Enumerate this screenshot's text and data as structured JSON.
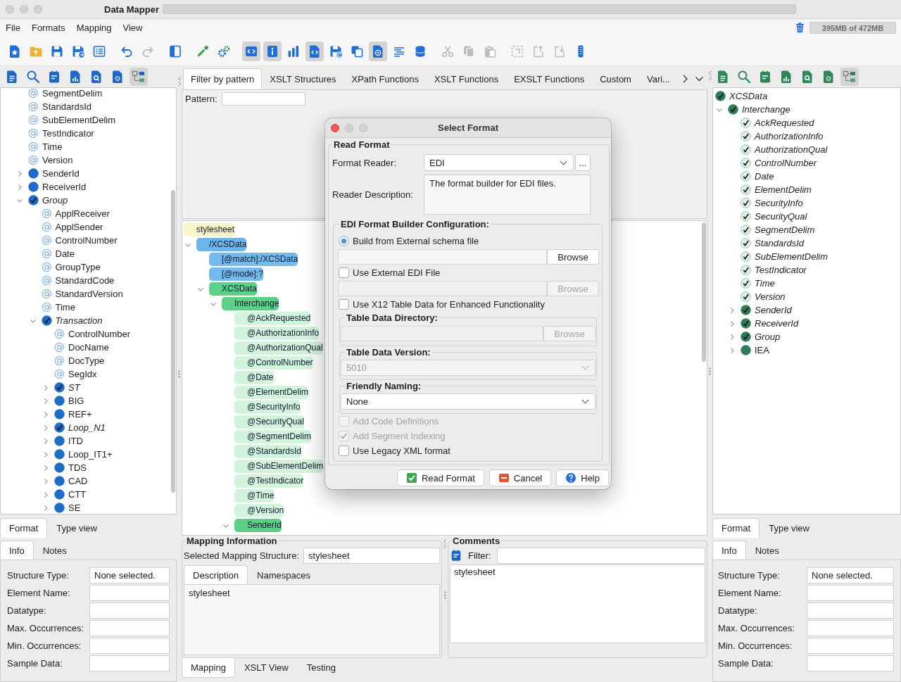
{
  "window": {
    "title": "Data Mapper"
  },
  "menu": [
    {
      "label": "File"
    },
    {
      "label": "Formats"
    },
    {
      "label": "Mapping"
    },
    {
      "label": "View"
    }
  ],
  "memory": {
    "reading": "395MB of 472MB"
  },
  "toolbar": {
    "groups": [
      {
        "buttons": [
          {
            "selected": false,
            "disabled": false
          },
          {
            "selected": false,
            "disabled": false
          },
          {
            "selected": false,
            "disabled": false
          },
          {
            "selected": false,
            "disabled": false
          },
          {
            "selected": false,
            "disabled": false
          }
        ]
      },
      {
        "buttons": [
          {
            "selected": false,
            "disabled": false
          },
          {
            "selected": false,
            "disabled": true
          }
        ]
      },
      {
        "buttons": [
          {
            "selected": false,
            "disabled": false
          }
        ]
      },
      {
        "buttons": [
          {
            "selected": false,
            "disabled": false
          },
          {
            "selected": false,
            "disabled": false
          }
        ]
      },
      {
        "buttons": [
          {
            "selected": true,
            "disabled": false
          },
          {
            "selected": true,
            "disabled": false
          },
          {
            "selected": false,
            "disabled": false
          },
          {
            "selected": true,
            "disabled": false
          },
          {
            "selected": false,
            "disabled": false
          },
          {
            "selected": false,
            "disabled": false
          },
          {
            "selected": true,
            "disabled": false
          },
          {
            "selected": false,
            "disabled": false
          },
          {
            "selected": false,
            "disabled": false
          }
        ]
      },
      {
        "buttons": [
          {
            "selected": false,
            "disabled": true
          },
          {
            "selected": false,
            "disabled": true
          },
          {
            "selected": false,
            "disabled": true
          }
        ]
      },
      {
        "buttons": [
          {
            "selected": false,
            "disabled": true
          },
          {
            "selected": false,
            "disabled": true
          },
          {
            "selected": false,
            "disabled": true
          },
          {
            "selected": false,
            "disabled": false
          }
        ]
      }
    ]
  },
  "format_panel": {
    "toolbar": [
      {
        "selected": false
      },
      {
        "selected": false
      },
      {
        "selected": false
      },
      {
        "selected": false
      },
      {
        "selected": false
      },
      {
        "selected": false
      },
      {
        "selected": true
      }
    ],
    "tree": [
      {
        "label": "SegmentDelim",
        "kind": "attribute",
        "checked": false
      },
      {
        "label": "StandardsId",
        "kind": "attribute",
        "checked": false
      },
      {
        "label": "SubElementDelim",
        "kind": "attribute",
        "checked": false
      },
      {
        "label": "TestIndicator",
        "kind": "attribute",
        "checked": false
      },
      {
        "label": "Time",
        "kind": "attribute",
        "checked": false
      },
      {
        "label": "Version",
        "kind": "attribute",
        "checked": false
      },
      {
        "label": "SenderId",
        "kind": "element",
        "checked": false,
        "expanded": false
      },
      {
        "label": "ReceiverId",
        "kind": "element",
        "checked": false,
        "expanded": false
      },
      {
        "label": "Group",
        "kind": "element",
        "checked": true,
        "expanded": true,
        "children": [
          {
            "label": "ApplReceiver",
            "kind": "attribute",
            "checked": false
          },
          {
            "label": "ApplSender",
            "kind": "attribute",
            "checked": false
          },
          {
            "label": "ControlNumber",
            "kind": "attribute",
            "checked": false
          },
          {
            "label": "Date",
            "kind": "attribute",
            "checked": false
          },
          {
            "label": "GroupType",
            "kind": "attribute",
            "checked": false
          },
          {
            "label": "StandardCode",
            "kind": "attribute",
            "checked": false
          },
          {
            "label": "StandardVersion",
            "kind": "attribute",
            "checked": false
          },
          {
            "label": "Time",
            "kind": "attribute",
            "checked": false
          },
          {
            "label": "Transaction",
            "kind": "element",
            "checked": true,
            "expanded": true,
            "children": [
              {
                "label": "ControlNumber",
                "kind": "attribute",
                "checked": false
              },
              {
                "label": "DocName",
                "kind": "attribute",
                "checked": false
              },
              {
                "label": "DocType",
                "kind": "attribute",
                "checked": false
              },
              {
                "label": "SegIdx",
                "kind": "attribute",
                "checked": false
              },
              {
                "label": "ST",
                "kind": "element",
                "checked": true,
                "expanded": false
              },
              {
                "label": "BIG",
                "kind": "element",
                "checked": false,
                "expanded": false
              },
              {
                "label": "REF+",
                "kind": "element",
                "checked": false,
                "expanded": false
              },
              {
                "label": "Loop_N1",
                "kind": "element",
                "checked": true,
                "expanded": false
              },
              {
                "label": "ITD",
                "kind": "element",
                "checked": false,
                "expanded": false
              },
              {
                "label": "Loop_IT1+",
                "kind": "element",
                "checked": false,
                "expanded": false
              },
              {
                "label": "TDS",
                "kind": "element",
                "checked": false,
                "expanded": false
              },
              {
                "label": "CAD",
                "kind": "element",
                "checked": false,
                "expanded": false
              },
              {
                "label": "CTT",
                "kind": "element",
                "checked": false,
                "expanded": false
              },
              {
                "label": "SE",
                "kind": "element",
                "checked": false,
                "expanded": false
              }
            ]
          }
        ]
      }
    ],
    "tabs": [
      {
        "label": "Format",
        "selected": true
      },
      {
        "label": "Type view",
        "selected": false
      }
    ],
    "info_tabs": [
      {
        "label": "Info",
        "selected": true
      },
      {
        "label": "Notes",
        "selected": false
      }
    ],
    "fields": [
      {
        "label": "Structure Type:",
        "value": "None selected."
      },
      {
        "label": "Element Name:"
      },
      {
        "label": "Datatype:"
      },
      {
        "label": "Max. Occurrences:"
      },
      {
        "label": "Min. Occurrences:"
      },
      {
        "label": "Sample Data:"
      }
    ]
  },
  "mapping_panel": {
    "tabs": [
      {
        "label": "Filter by pattern",
        "selected": true
      },
      {
        "label": "XSLT Structures",
        "selected": false
      },
      {
        "label": "XPath Functions",
        "selected": false
      },
      {
        "label": "XSLT Functions",
        "selected": false
      },
      {
        "label": "EXSLT Functions",
        "selected": false
      },
      {
        "label": "Custom",
        "selected": false
      },
      {
        "label": "Vari...",
        "selected": false
      }
    ],
    "pattern": {
      "label": "Pattern:"
    },
    "tree": [
      {
        "label": "stylesheet",
        "kind": "stylesheet",
        "children": [
          {
            "label": "/XCSData",
            "kind": "template",
            "expanded": true,
            "children": [
              {
                "label": "[@match]:/XCSData",
                "kind": "parameter"
              },
              {
                "label": "[@mode]:?",
                "kind": "parameter"
              },
              {
                "label": "XCSData",
                "kind": "element",
                "expanded": true,
                "children": [
                  {
                    "label": "Interchange",
                    "kind": "element",
                    "expanded": true,
                    "children": [
                      {
                        "label": "@AckRequested",
                        "kind": "attribute"
                      },
                      {
                        "label": "@AuthorizationInfo",
                        "kind": "attribute"
                      },
                      {
                        "label": "@AuthorizationQual",
                        "kind": "attribute"
                      },
                      {
                        "label": "@ControlNumber",
                        "kind": "attribute"
                      },
                      {
                        "label": "@Date",
                        "kind": "attribute"
                      },
                      {
                        "label": "@ElementDelim",
                        "kind": "attribute"
                      },
                      {
                        "label": "@SecurityInfo",
                        "kind": "attribute"
                      },
                      {
                        "label": "@SecurityQual",
                        "kind": "attribute"
                      },
                      {
                        "label": "@SegmentDelim",
                        "kind": "attribute"
                      },
                      {
                        "label": "@StandardsId",
                        "kind": "attribute"
                      },
                      {
                        "label": "@SubElementDelim",
                        "kind": "attribute"
                      },
                      {
                        "label": "@TestIndicator",
                        "kind": "attribute"
                      },
                      {
                        "label": "@Time",
                        "kind": "attribute"
                      },
                      {
                        "label": "@Version",
                        "kind": "attribute"
                      },
                      {
                        "label": "SenderId",
                        "kind": "element",
                        "expanded": true
                      }
                    ]
                  }
                ]
              }
            ]
          }
        ]
      }
    ],
    "info": {
      "title": "Mapping Information",
      "structure_label": "Selected Mapping Structure:",
      "structure_value": "stylesheet",
      "tabs": [
        {
          "label": "Description",
          "selected": true
        },
        {
          "label": "Namespaces",
          "selected": false
        }
      ],
      "description": "stylesheet"
    },
    "view_tabs": [
      {
        "label": "Mapping",
        "selected": true
      },
      {
        "label": "XSLT View",
        "selected": false
      },
      {
        "label": "Testing",
        "selected": false
      }
    ]
  },
  "comments": {
    "title": "Comments",
    "filter_label": "Filter:",
    "items": [
      "stylesheet"
    ]
  },
  "schema_panel": {
    "toolbar": [
      {
        "selected": false
      },
      {
        "selected": false
      },
      {
        "selected": false
      },
      {
        "selected": false
      },
      {
        "selected": false
      },
      {
        "selected": false
      },
      {
        "selected": true
      }
    ],
    "tree": [
      {
        "label": "XCSData",
        "kind": "element",
        "checked": true,
        "children": [
          {
            "label": "Interchange",
            "kind": "element",
            "checked": true,
            "expanded": true,
            "children": [
              {
                "label": "AckRequested",
                "kind": "attribute",
                "checked": true
              },
              {
                "label": "AuthorizationInfo",
                "kind": "attribute",
                "checked": true
              },
              {
                "label": "AuthorizationQual",
                "kind": "attribute",
                "checked": true
              },
              {
                "label": "ControlNumber",
                "kind": "attribute",
                "checked": true
              },
              {
                "label": "Date",
                "kind": "attribute",
                "checked": true
              },
              {
                "label": "ElementDelim",
                "kind": "attribute",
                "checked": true
              },
              {
                "label": "SecurityInfo",
                "kind": "attribute",
                "checked": true
              },
              {
                "label": "SecurityQual",
                "kind": "attribute",
                "checked": true
              },
              {
                "label": "SegmentDelim",
                "kind": "attribute",
                "checked": true
              },
              {
                "label": "StandardsId",
                "kind": "attribute",
                "checked": true
              },
              {
                "label": "SubElementDelim",
                "kind": "attribute",
                "checked": true
              },
              {
                "label": "TestIndicator",
                "kind": "attribute",
                "checked": true
              },
              {
                "label": "Time",
                "kind": "attribute",
                "checked": true
              },
              {
                "label": "Version",
                "kind": "attribute",
                "checked": true
              },
              {
                "label": "SenderId",
                "kind": "element",
                "checked": true,
                "expanded": false
              },
              {
                "label": "ReceiverId",
                "kind": "element",
                "checked": true,
                "expanded": false
              },
              {
                "label": "Group",
                "kind": "element",
                "checked": true,
                "expanded": false
              },
              {
                "label": "IEA",
                "kind": "element",
                "checked": false,
                "expanded": false
              }
            ]
          }
        ]
      }
    ],
    "tabs": [
      {
        "label": "Format",
        "selected": true
      },
      {
        "label": "Type view",
        "selected": false
      }
    ],
    "info_tabs": [
      {
        "label": "Info",
        "selected": true
      },
      {
        "label": "Notes",
        "selected": false
      }
    ],
    "fields": [
      {
        "label": "Structure Type:",
        "value": "None selected."
      },
      {
        "label": "Element Name:"
      },
      {
        "label": "Datatype:"
      },
      {
        "label": "Max. Occurrences:"
      },
      {
        "label": "Min. Occurrences:"
      },
      {
        "label": "Sample Data:"
      }
    ]
  },
  "dialog": {
    "title": "Select Format",
    "group_title": "Read Format",
    "reader": {
      "label": "Format Reader:",
      "value": "EDI",
      "more": "..."
    },
    "description": {
      "label": "Reader Description:",
      "value": "The format builder for EDI files."
    },
    "config": {
      "title": "EDI Format Builder Configuration:",
      "rows": [
        {
          "kind": "radio",
          "label": "Build from External schema file",
          "selected": true
        },
        {
          "kind": "file",
          "browse": "Browse",
          "disabled": false
        },
        {
          "kind": "checkbox",
          "label": "Use External EDI File",
          "checked": false,
          "disabled": false
        },
        {
          "kind": "file",
          "browse": "Browse",
          "disabled": true
        },
        {
          "kind": "checkbox",
          "label": "Use X12 Table Data for Enhanced Functionality",
          "checked": false,
          "disabled": false
        },
        {
          "kind": "group",
          "title": "Table Data Directory:",
          "control": {
            "kind": "file",
            "browse": "Browse",
            "disabled": true
          }
        },
        {
          "kind": "group",
          "title": "Table Data Version:",
          "control": {
            "kind": "combo",
            "value": "5010",
            "disabled": true
          }
        },
        {
          "kind": "group",
          "title": "Friendly Naming:",
          "control": {
            "kind": "combo",
            "value": "None",
            "disabled": false
          }
        },
        {
          "kind": "checkbox",
          "label": "Add Code Definitions",
          "checked": false,
          "disabled": true
        },
        {
          "kind": "checkbox",
          "label": "Add Segment Indexing",
          "checked": true,
          "disabled": true
        },
        {
          "kind": "checkbox",
          "label": "Use Legacy XML format",
          "checked": false,
          "disabled": false
        }
      ]
    },
    "buttons": [
      {
        "label": "Read Format",
        "kind": "confirm"
      },
      {
        "label": "Cancel",
        "kind": "cancel"
      },
      {
        "label": "Help",
        "kind": "help"
      }
    ]
  }
}
